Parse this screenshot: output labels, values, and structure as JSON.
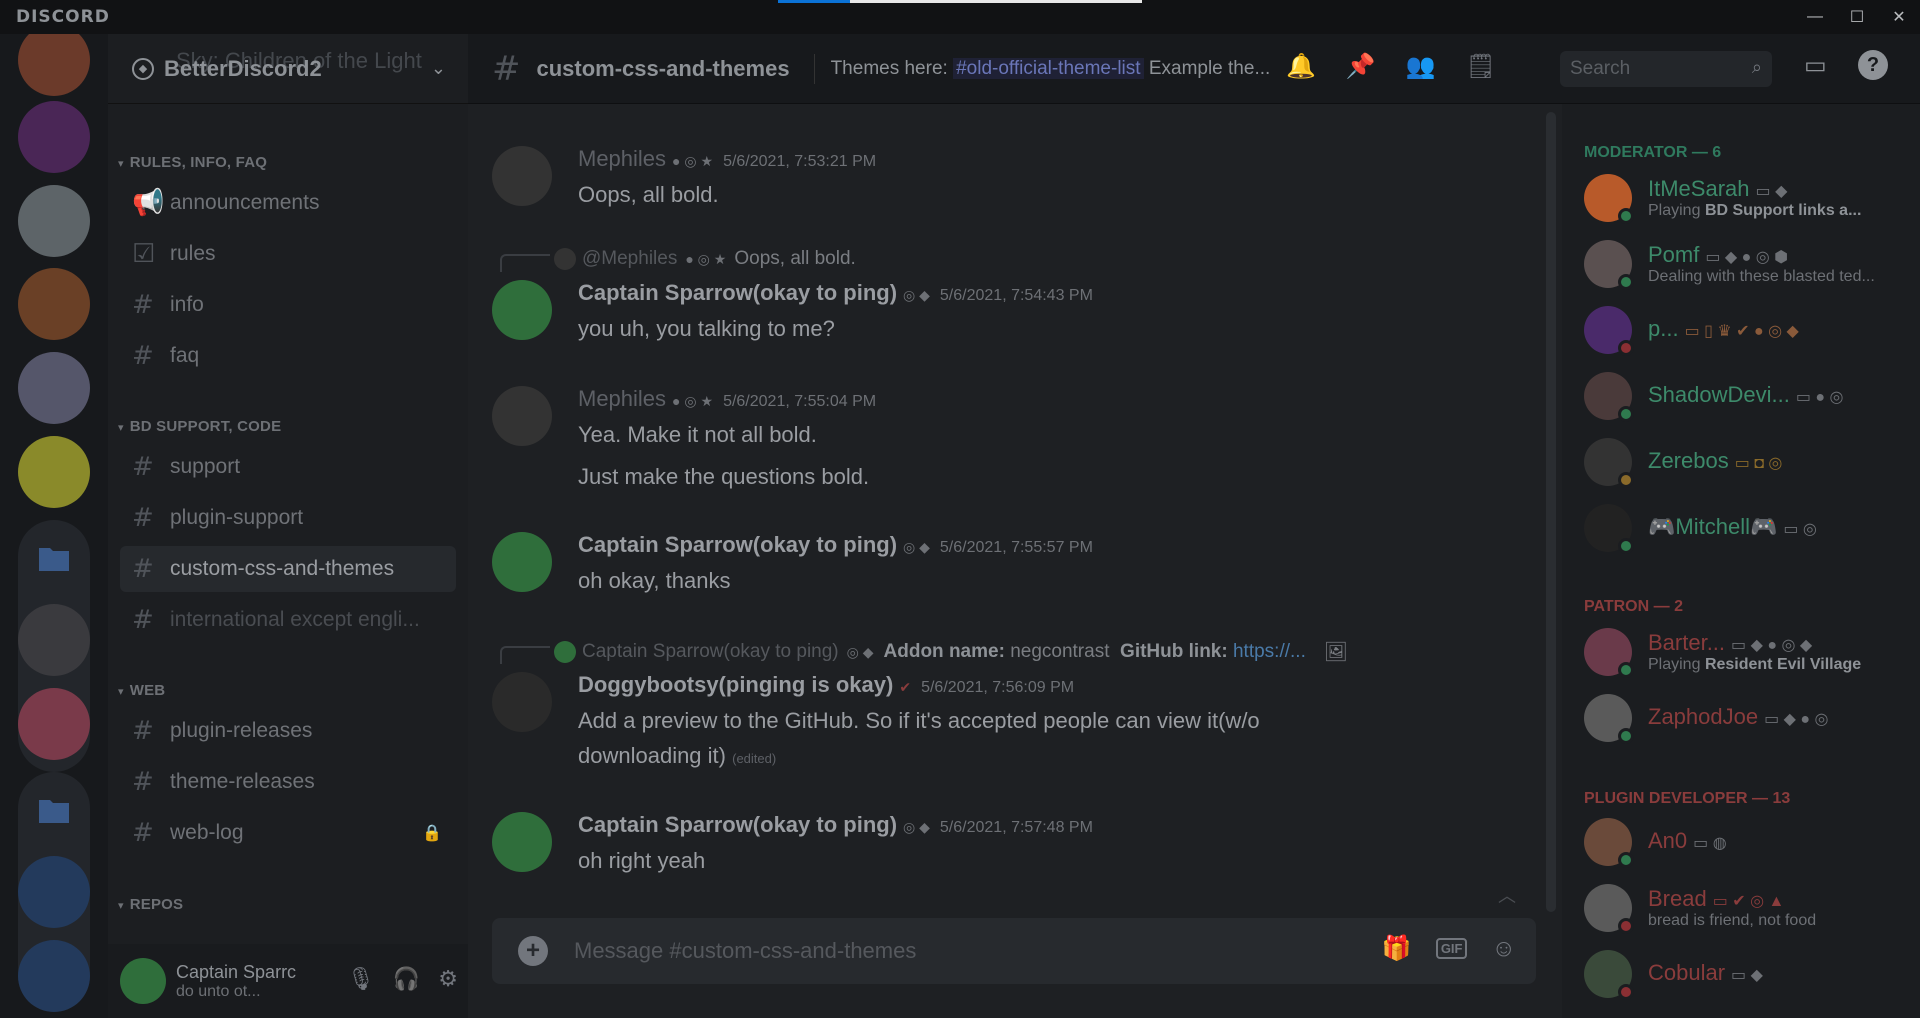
{
  "app": {
    "brand": "DISCORD"
  },
  "window": {
    "minimize": "—",
    "maximize": "☐",
    "close": "✕"
  },
  "guild": {
    "name": "BetterDiscord2",
    "ghost_channel": "Sky: Children of the Light"
  },
  "categories": [
    {
      "label": "RULES, INFO, FAQ"
    },
    {
      "label": "BD SUPPORT, CODE"
    },
    {
      "label": "WEB"
    },
    {
      "label": "REPOS"
    }
  ],
  "channels": [
    {
      "name": "announcements",
      "icon": "megaphone-icon"
    },
    {
      "name": "rules",
      "icon": "checkbox-icon"
    },
    {
      "name": "info",
      "icon": "hash-icon"
    },
    {
      "name": "faq",
      "icon": "hash-icon"
    },
    {
      "name": "support",
      "icon": "hash-icon"
    },
    {
      "name": "plugin-support",
      "icon": "hash-icon"
    },
    {
      "name": "custom-css-and-themes",
      "icon": "hash-icon"
    },
    {
      "name": "international except engli...",
      "icon": "hash-icon"
    },
    {
      "name": "plugin-releases",
      "icon": "hash-icon"
    },
    {
      "name": "theme-releases",
      "icon": "hash-icon"
    },
    {
      "name": "web-log",
      "icon": "hash-lock-icon"
    }
  ],
  "user": {
    "name": "Captain Sparrc",
    "status": "do unto ot..."
  },
  "channel_header": {
    "title": "custom-css-and-themes",
    "topic_prefix": "Themes here:",
    "topic_mention": "#old-official-theme-list",
    "topic_suffix": "Example the...",
    "search_placeholder": "Search"
  },
  "messages": [
    {
      "author": "Mephiles",
      "timestamp": "5/6/2021, 7:53:21 PM",
      "lines": [
        "Oops, all bold."
      ]
    },
    {
      "reply_name": "@Mephiles",
      "reply_text": "Oops, all bold.",
      "author": "Captain Sparrow(okay to ping)",
      "timestamp": "5/6/2021, 7:54:43 PM",
      "lines": [
        "you uh, you talking to me?"
      ]
    },
    {
      "author": "Mephiles",
      "timestamp": "5/6/2021, 7:55:04 PM",
      "lines": [
        "Yea.  Make it not all bold.",
        "Just make the questions bold."
      ]
    },
    {
      "author": "Captain Sparrow(okay to ping)",
      "timestamp": "5/6/2021, 7:55:57 PM",
      "lines": [
        "oh okay, thanks"
      ]
    },
    {
      "reply_name": "Captain Sparrow(okay to ping)",
      "reply_label1": "Addon name:",
      "reply_val1": "negcontrast",
      "reply_label2": "GitHub link:",
      "reply_link": "https://...",
      "author": "Doggybootsy(pinging is okay)",
      "timestamp": "5/6/2021, 7:56:09 PM",
      "lines": [
        "Add a preview to the GitHub. So if it's accepted people can view it(w/o",
        "downloading it)"
      ],
      "edited": "(edited)"
    },
    {
      "author": "Captain Sparrow(okay to ping)",
      "timestamp": "5/6/2021, 7:57:48 PM",
      "lines": [
        "oh right yeah"
      ]
    }
  ],
  "composer": {
    "placeholder": "Message #custom-css-and-themes",
    "gif": "GIF"
  },
  "member_groups": [
    {
      "label": "MODERATOR — 6"
    },
    {
      "label": "PATRON — 2"
    },
    {
      "label": "PLUGIN DEVELOPER — 13"
    }
  ],
  "members": [
    {
      "name": "ItMeSarah",
      "status_prefix": "Playing",
      "status_bold": "BD Support links a...",
      "color": "#3d8a6a",
      "presence": "online"
    },
    {
      "name": "Pomf",
      "status_prefix": "",
      "status_bold": "",
      "status_text": "Dealing with these blasted ted...",
      "color": "#3d8a6a",
      "presence": "online"
    },
    {
      "name": "p...",
      "status_text": "",
      "color": "#3d8a6a",
      "presence": "dnd"
    },
    {
      "name": "ShadowDevi...",
      "status_text": "",
      "color": "#3d8a6a",
      "presence": "online"
    },
    {
      "name": "Zerebos",
      "status_text": "",
      "color": "#3d8a6a",
      "presence": "idle"
    },
    {
      "name": "🎮Mitchell🎮",
      "status_text": "",
      "color": "#3d8a6a",
      "presence": "online"
    },
    {
      "name": "Barter...",
      "status_prefix": "Playing",
      "status_bold": "Resident Evil Village",
      "color": "#8a3c3c",
      "presence": "online"
    },
    {
      "name": "ZaphodJoe",
      "status_text": "",
      "color": "#8a3c3c",
      "presence": "online"
    },
    {
      "name": "An0",
      "status_text": "",
      "color": "#8a3c3c",
      "presence": "online"
    },
    {
      "name": "Bread",
      "status_text": "bread is friend, not food",
      "color": "#8a3c3c",
      "presence": "dnd"
    },
    {
      "name": "Cobular",
      "status_text": "",
      "color": "#8a3c3c",
      "presence": "dnd"
    }
  ],
  "colors": {
    "online": "#2f7a4e",
    "dnd": "#8a2f33",
    "idle": "#8a6a2a"
  }
}
